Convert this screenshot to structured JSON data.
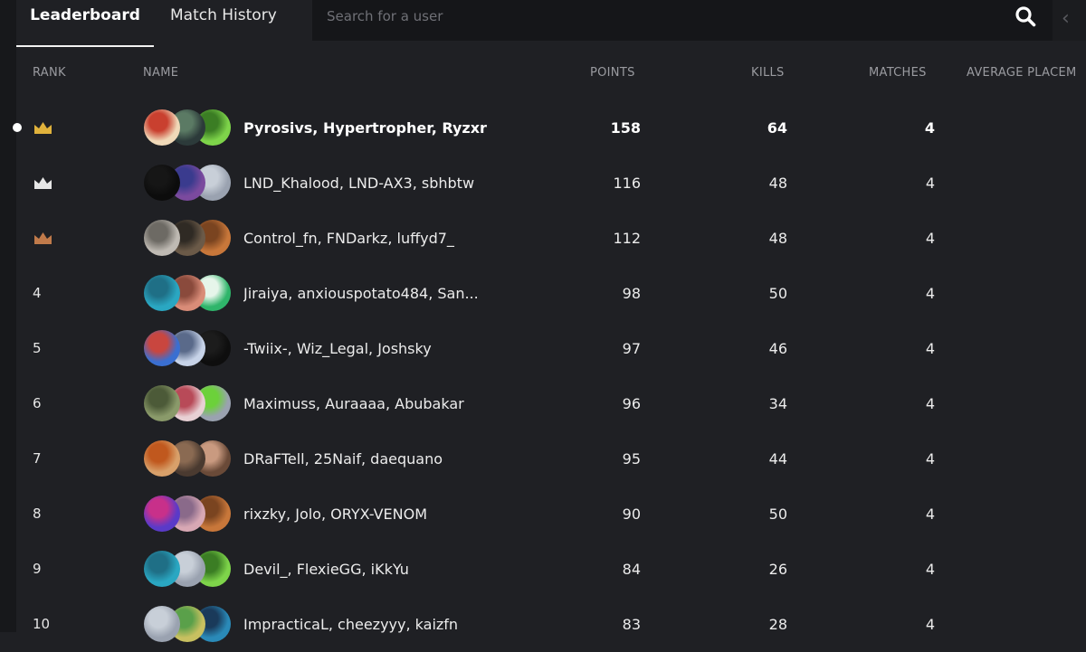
{
  "tabs": [
    {
      "label": "Leaderboard",
      "active": true
    },
    {
      "label": "Match History",
      "active": false
    }
  ],
  "search": {
    "placeholder": "Search for a user",
    "icon": "search-icon"
  },
  "columns": {
    "rank": "RANK",
    "name": "NAME",
    "points": "POINTS",
    "kills": "KILLS",
    "matches": "MATCHES",
    "avg": "AVERAGE PLACEM"
  },
  "colors": {
    "gold": "#e0b23c",
    "silver": "#e6e6e6",
    "bronze": "#c07a4a"
  },
  "rows": [
    {
      "rank": "1",
      "icon": "crown-gold",
      "names": "Pyrosivs, Hypertropher, Ryzxr",
      "points": "158",
      "kills": "64",
      "matches": "4",
      "avatars": [
        [
          "#f0d9b8",
          "#c9402f"
        ],
        [
          "#2c3a3a",
          "#5b7a64"
        ],
        [
          "#7ed44a",
          "#3b7d24"
        ]
      ]
    },
    {
      "rank": "2",
      "icon": "crown-silver",
      "names": "LND_Khalood, LND-AX3, sbhbtw",
      "points": "116",
      "kills": "48",
      "matches": "4",
      "avatars": [
        [
          "#0c0c0c",
          "#161616"
        ],
        [
          "#7b4a9e",
          "#3a3b8e"
        ],
        [
          "#9aa2b0",
          "#c8cfd8"
        ]
      ]
    },
    {
      "rank": "3",
      "icon": "crown-bronze",
      "names": "Control_fn, FNDarkz, luffyd7_",
      "points": "112",
      "kills": "48",
      "matches": "4",
      "avatars": [
        [
          "#bfbab3",
          "#6d6a64"
        ],
        [
          "#6b5a48",
          "#2f2a24"
        ],
        [
          "#c8773a",
          "#7a4420"
        ]
      ]
    },
    {
      "rank": "4",
      "icon": "",
      "names": "Jiraiya, anxiouspotato484, San...",
      "points": "98",
      "kills": "50",
      "matches": "4",
      "avatars": [
        [
          "#2aa7c2",
          "#1f6f86"
        ],
        [
          "#d98c78",
          "#8a4a3c"
        ],
        [
          "#2fb56a",
          "#e6f5ea"
        ]
      ]
    },
    {
      "rank": "5",
      "icon": "",
      "names": "-Twiix-, Wiz_Legal, Joshsky",
      "points": "97",
      "kills": "46",
      "matches": "4",
      "avatars": [
        [
          "#3a6fd1",
          "#c9463f"
        ],
        [
          "#c7d3e8",
          "#5a6a8a"
        ],
        [
          "#0e0e0e",
          "#1c1c1c"
        ]
      ]
    },
    {
      "rank": "6",
      "icon": "",
      "names": "Maximuss, Auraaaa, Abubakar",
      "points": "96",
      "kills": "34",
      "matches": "4",
      "avatars": [
        [
          "#8a9a6a",
          "#4c5a38"
        ],
        [
          "#e8d0d4",
          "#b84a58"
        ],
        [
          "#9aa2b0",
          "#6cd13a"
        ]
      ]
    },
    {
      "rank": "7",
      "icon": "",
      "names": "DRaFTell, 25Naif, daequano",
      "points": "95",
      "kills": "44",
      "matches": "4",
      "avatars": [
        [
          "#d8a06a",
          "#c0581e"
        ],
        [
          "#4a3a30",
          "#8a6a52"
        ],
        [
          "#6a4a38",
          "#c99a80"
        ]
      ]
    },
    {
      "rank": "8",
      "icon": "",
      "names": "rixzky, Jolo, ORYX-VENOM",
      "points": "90",
      "kills": "50",
      "matches": "4",
      "avatars": [
        [
          "#5a3ac8",
          "#c8308a"
        ],
        [
          "#d8a8b4",
          "#8a6a8a"
        ],
        [
          "#c8773a",
          "#7a4420"
        ]
      ]
    },
    {
      "rank": "9",
      "icon": "",
      "names": "Devil_, FlexieGG, iKkYu",
      "points": "84",
      "kills": "26",
      "matches": "4",
      "avatars": [
        [
          "#2aa7c2",
          "#1f6f86"
        ],
        [
          "#9aa2b0",
          "#c8cfd8"
        ],
        [
          "#7ed44a",
          "#3b7d24"
        ]
      ]
    },
    {
      "rank": "10",
      "icon": "",
      "names": "ImpracticaL, cheezyyy, kaizfn",
      "points": "83",
      "kills": "28",
      "matches": "4",
      "avatars": [
        [
          "#9aa2b0",
          "#c8cfd8"
        ],
        [
          "#c8c060",
          "#5aa04a"
        ],
        [
          "#2a8ab8",
          "#1a3a5a"
        ]
      ]
    }
  ]
}
